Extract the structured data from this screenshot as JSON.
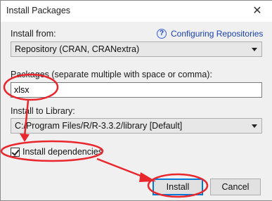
{
  "window": {
    "title": "Install Packages",
    "close_glyph": "✕"
  },
  "install_from": {
    "label": "Install from:",
    "help_icon": "?",
    "help_link": "Configuring Repositories",
    "selected": "Repository (CRAN, CRANextra)"
  },
  "packages": {
    "label": "Packages (separate multiple with space or comma):",
    "value": "xlsx"
  },
  "library": {
    "label": "Install to Library:",
    "selected": "C:/Program Files/R/R-3.3.2/library [Default]"
  },
  "dependencies": {
    "label": "Install dependencies",
    "checked": true
  },
  "buttons": {
    "install": "Install",
    "cancel": "Cancel"
  },
  "colors": {
    "annotation": "#e8262c",
    "link": "#1a3fb0",
    "focus": "#0078d7"
  }
}
